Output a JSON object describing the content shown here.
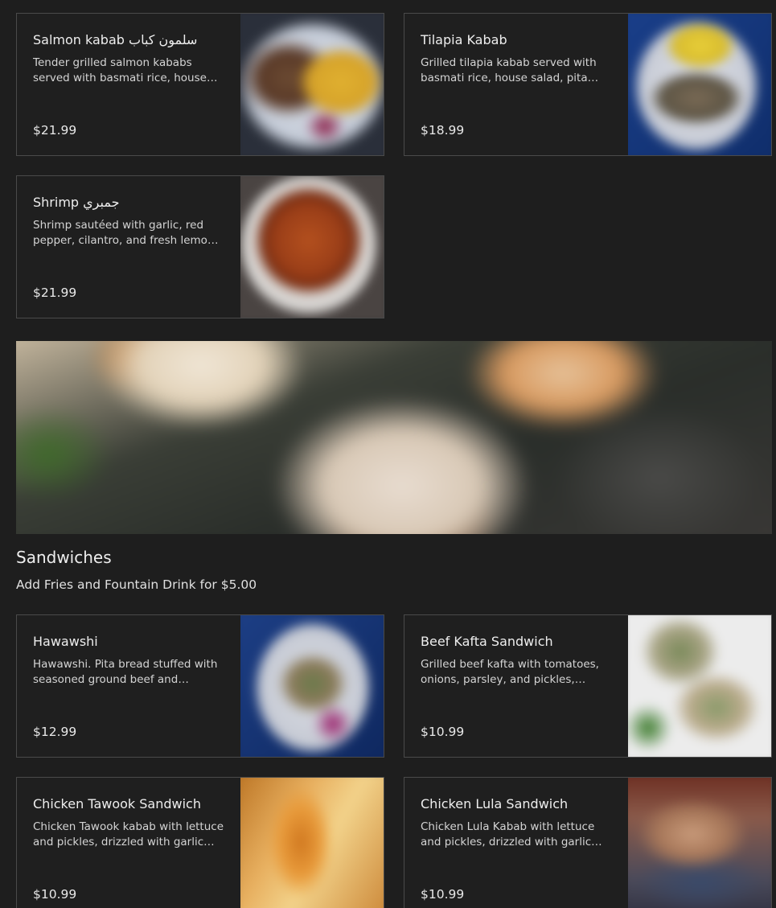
{
  "top_items": [
    {
      "title": "Salmon kabab سلمون كباب",
      "description": "Tender grilled salmon kababs served with basmati rice, house salad, pita bread and sauces",
      "price": "$21.99"
    },
    {
      "title": "Tilapia Kabab",
      "description": "Grilled tilapia kabab served with basmati rice, house salad, pita bread and sauces",
      "price": "$18.99"
    },
    {
      "title": "Shrimp جمبري",
      "description": "Shrimp sautéed with garlic, red pepper, cilantro, and fresh lemon juice",
      "price": "$21.99"
    }
  ],
  "section": {
    "title": "Sandwiches",
    "subtitle": "Add Fries and Fountain Drink for $5.00"
  },
  "sandwich_items": [
    {
      "title": "Hawawshi",
      "description": "Hawawshi. Pita bread stuffed with seasoned ground beef and vegetables, baked until crispy",
      "price": "$12.99"
    },
    {
      "title": "Beef Kafta Sandwich",
      "description": "Grilled beef kafta with tomatoes, onions, parsley, and pickles, drizzled with tahini",
      "price": "$10.99"
    },
    {
      "title": "Chicken Tawook Sandwich",
      "description": "Chicken Tawook kabab with lettuce and pickles, drizzled with garlic sauce",
      "price": "$10.99"
    },
    {
      "title": "Chicken Lula Sandwich",
      "description": "Chicken Lula Kabab with lettuce and pickles, drizzled with garlic sauce",
      "price": "$10.99"
    }
  ]
}
